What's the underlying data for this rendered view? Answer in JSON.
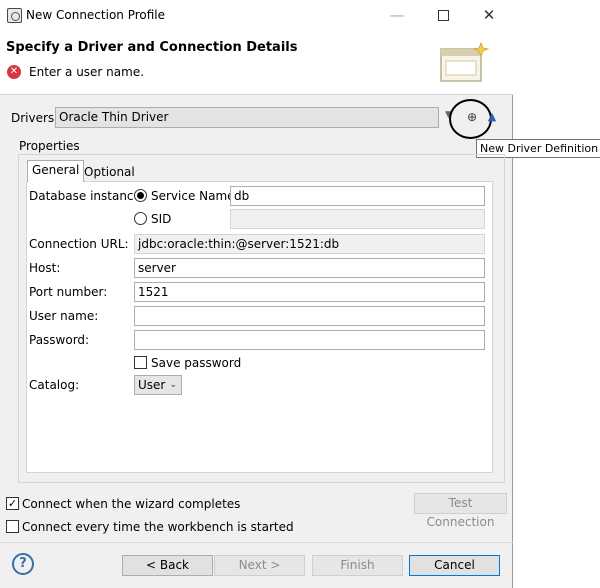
{
  "window": {
    "title": "New Connection Profile",
    "minimize_glyph": "—",
    "close_glyph": "✕"
  },
  "banner": {
    "heading": "Specify a Driver and Connection Details",
    "message": "Enter a user name."
  },
  "drivers": {
    "label": "Drivers:",
    "selected": "Oracle Thin Driver",
    "new_driver_tooltip": "New Driver Definition"
  },
  "properties": {
    "group_label": "Properties",
    "tabs": [
      {
        "label": "General",
        "active": true
      },
      {
        "label": "Optional",
        "active": false
      }
    ],
    "database_instance_label": "Database instance:",
    "service_name_label": "Service Name",
    "service_name_value": "db",
    "sid_label": "SID",
    "sid_value": "",
    "connection_url_label": "Connection URL:",
    "connection_url_value": "jdbc:oracle:thin:@server:1521:db",
    "host_label": "Host:",
    "host_value": "server",
    "port_label": "Port number:",
    "port_value": "1521",
    "username_label": "User name:",
    "username_value": "",
    "password_label": "Password:",
    "password_value": "",
    "save_password_label": "Save password",
    "save_password_checked": false,
    "catalog_label": "Catalog:",
    "catalog_value": "User"
  },
  "options": {
    "connect_on_finish_label": "Connect when the wizard completes",
    "connect_on_finish_checked": true,
    "connect_on_start_label": "Connect every time the workbench is started",
    "connect_on_start_checked": false,
    "test_connection_label": "Test Connection"
  },
  "footer": {
    "back_label": "< Back",
    "next_label": "Next >",
    "finish_label": "Finish",
    "cancel_label": "Cancel"
  },
  "colors": {
    "error": "#d9363e",
    "dialog_bg": "#f0f0f0",
    "focus_border": "#0078d7"
  }
}
